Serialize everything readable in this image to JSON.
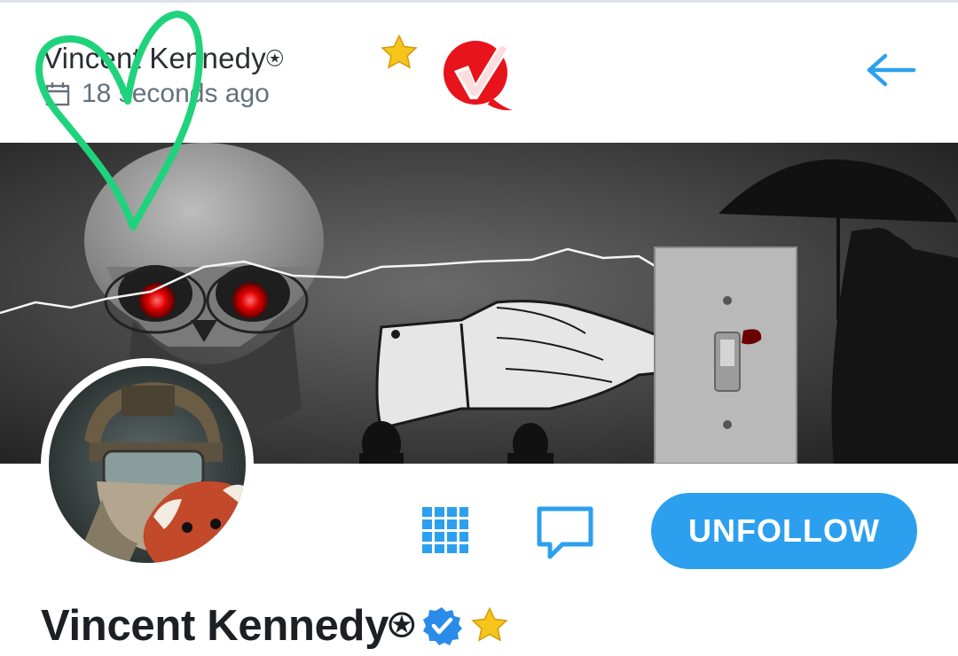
{
  "header": {
    "title": "Vincent Kennedy⍟",
    "timestamp": "18 seconds ago"
  },
  "icons": {
    "calendar": "calendar-icon",
    "star": "star-icon",
    "badge": "red-checkmark-logo",
    "back": "arrow-left-icon",
    "grid": "grid-icon",
    "message": "message-icon",
    "verified": "verified-icon",
    "heart": "heart-doodle"
  },
  "actions": {
    "unfollow_label": "UNFOLLOW"
  },
  "profile": {
    "name": "Vincent Kennedy⍟"
  },
  "colors": {
    "accent": "#2ca0ee",
    "star": "#f6c51c",
    "heart": "#1fd37c",
    "badge_red": "#e8141c",
    "text_dark": "#1c1f23",
    "text_muted": "#64717d"
  }
}
